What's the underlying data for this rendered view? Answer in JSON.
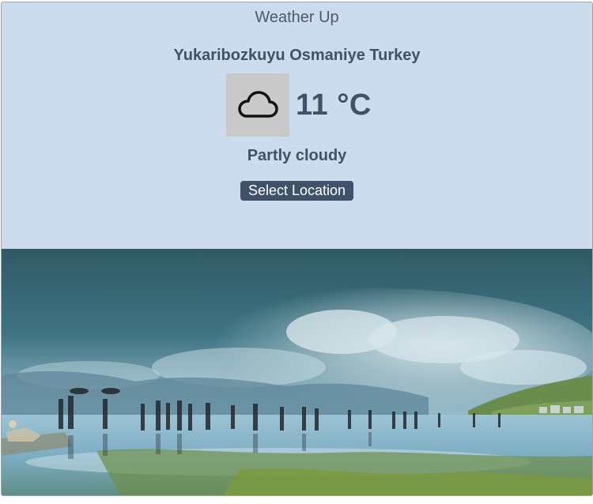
{
  "app": {
    "title": "Weather Up"
  },
  "weather": {
    "location": "Yukaribozkuyu Osmaniye Turkey",
    "temperature": "11 °C",
    "condition": "Partly cloudy",
    "icon": "cloud-icon"
  },
  "actions": {
    "select_location_label": "Select Location"
  },
  "background": {
    "scene": "lakeshore-photo",
    "colors": {
      "panel": "#cddced",
      "text": "#3f5269",
      "button": "#3f5269",
      "icon_box": "#c9c9c9"
    }
  }
}
